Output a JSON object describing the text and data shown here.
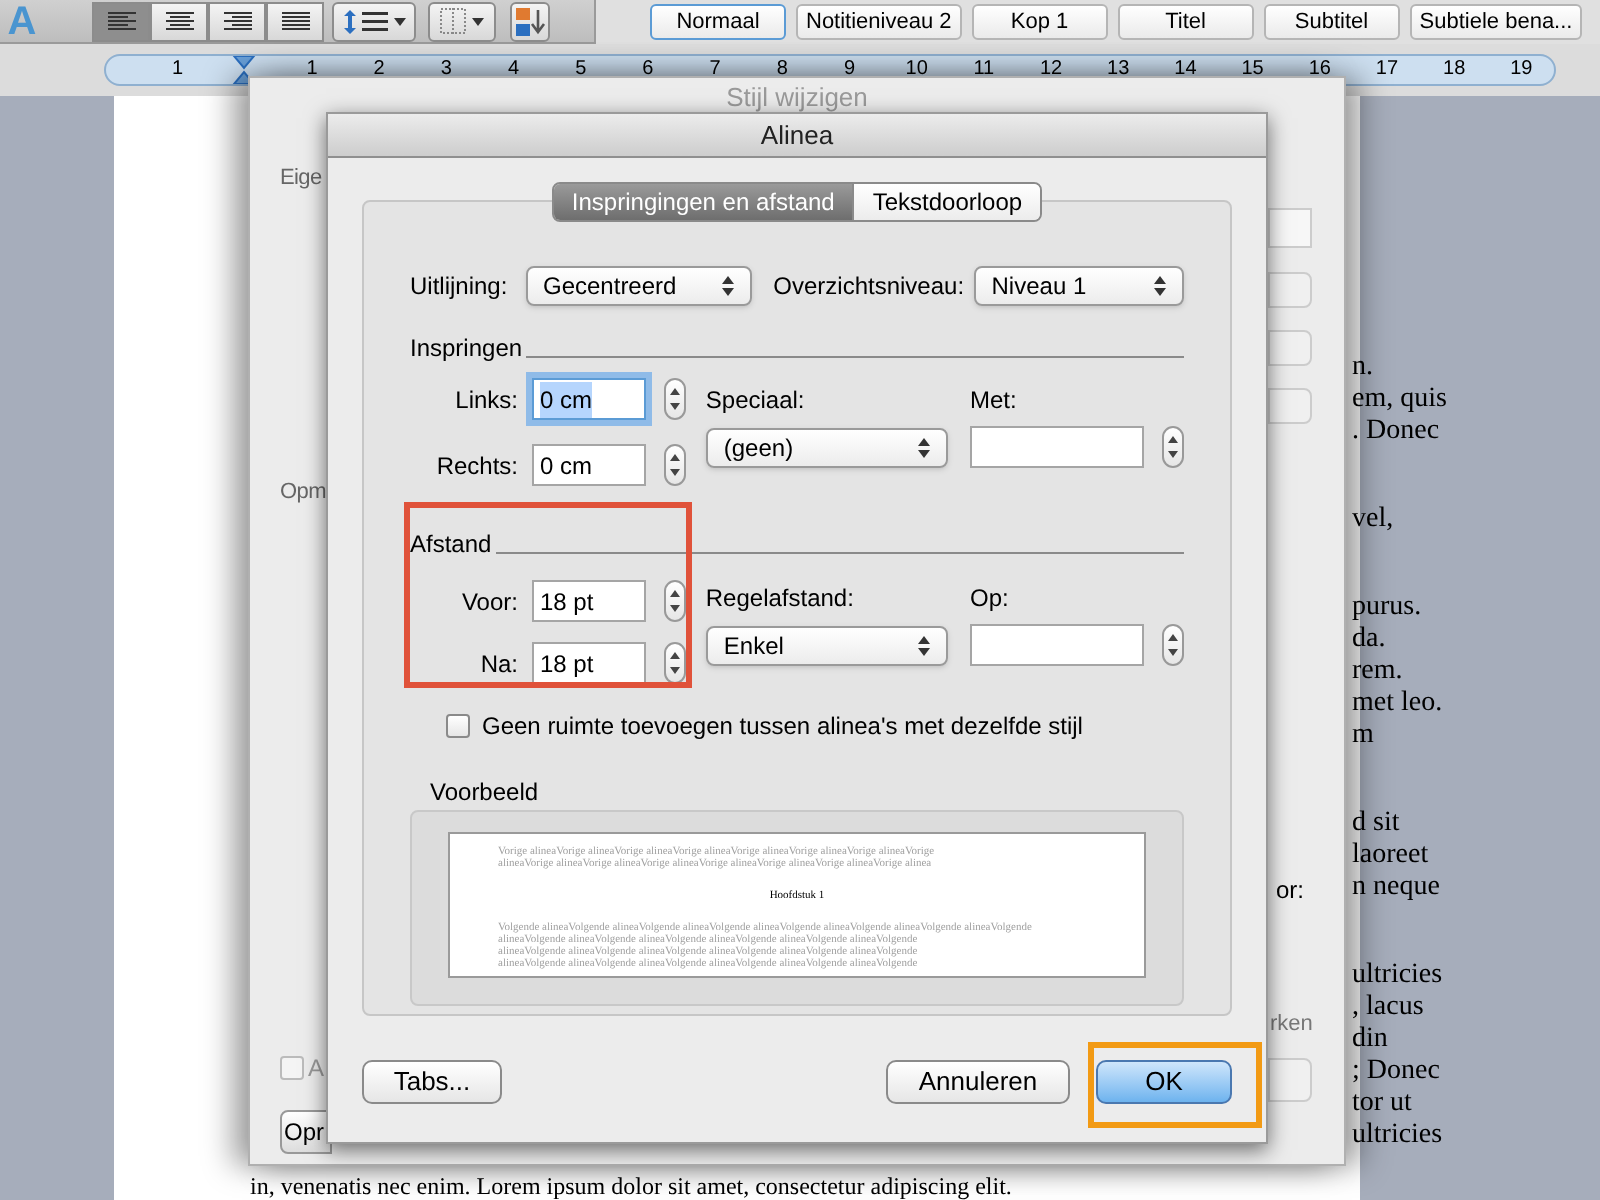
{
  "toolbar": {
    "text_effects": "A",
    "align_buttons": [
      {
        "kind": "left",
        "selected": true
      },
      {
        "kind": "center",
        "selected": false
      },
      {
        "kind": "right",
        "selected": false
      },
      {
        "kind": "justify",
        "selected": false
      }
    ],
    "styles": [
      {
        "label": "Normaal",
        "selected": true
      },
      {
        "label": "Notitieniveau 2",
        "selected": false
      },
      {
        "label": "Kop 1",
        "selected": false
      },
      {
        "label": "Titel",
        "selected": false
      },
      {
        "label": "Subtitel",
        "selected": false
      },
      {
        "label": "Subtiele bena...",
        "selected": false
      }
    ]
  },
  "ruler": {
    "numbers": [
      "1",
      "1",
      "2",
      "3",
      "4",
      "5",
      "6",
      "7",
      "8",
      "9",
      "10",
      "11",
      "12",
      "13",
      "14",
      "15",
      "16",
      "17",
      "18",
      "19"
    ]
  },
  "document": {
    "paragraphs": [
      [
        "n.",
        "em, quis",
        ". Donec"
      ],
      [
        "vel,"
      ],
      [
        "purus.",
        "da.",
        "rem.",
        "met leo.",
        "m"
      ],
      [
        "d sit",
        "laoreet",
        "n neque"
      ],
      [
        "ultricies",
        ", lacus",
        "din",
        "; Donec",
        "tor ut",
        "ultricies"
      ]
    ],
    "bottom_line": "in, venenatis nec enim. Lorem ipsum dolor sit amet, consectetur adipiscing elit."
  },
  "style_dialog": {
    "title": "Stijl wijzigen",
    "labels": [
      "Eige",
      "Opm"
    ],
    "right_labels": [
      "or:",
      "rken"
    ],
    "checkbox": {
      "label": "A",
      "checked": false
    },
    "button": "Opr"
  },
  "dialog": {
    "title": "Alinea",
    "tabs": [
      {
        "label": "Inspringingen en afstand",
        "selected": true
      },
      {
        "label": "Tekstdoorloop",
        "selected": false
      }
    ],
    "alignment": {
      "label": "Uitlijning:",
      "value": "Gecentreerd"
    },
    "outline_level": {
      "label": "Overzichtsniveau:",
      "value": "Niveau 1"
    },
    "indent": {
      "heading": "Inspringen",
      "fields": [
        {
          "label": "Links:",
          "value": "0 cm",
          "focused": true
        },
        {
          "label": "Rechts:",
          "value": "0 cm",
          "focused": false
        }
      ],
      "special": {
        "label": "Speciaal:",
        "value": "(geen)"
      },
      "by": {
        "label": "Met:"
      }
    },
    "spacing": {
      "heading": "Afstand",
      "fields": [
        {
          "label": "Voor:",
          "value": "18 pt",
          "focused": false
        },
        {
          "label": "Na:",
          "value": "18 pt",
          "focused": false
        }
      ],
      "line_spacing": {
        "label": "Regelafstand:",
        "value": "Enkel"
      },
      "at": {
        "label": "Op:"
      }
    },
    "no_extra_space": {
      "label": "Geen ruimte toevoegen tussen alinea's met dezelfde stijl",
      "checked": false
    },
    "preview": {
      "label": "Voorbeeld",
      "previous_lines": [
        "Vorige alineaVorige alineaVorige alineaVorige alineaVorige alineaVorige alineaVorige alineaVorige",
        "alineaVorige alineaVorige alineaVorige alineaVorige alineaVorige alineaVorige alineaVorige alinea"
      ],
      "heading": "Hoofdstuk 1",
      "next_lines": [
        "Volgende alineaVolgende alineaVolgende alineaVolgende alineaVolgende alineaVolgende alineaVolgende alineaVolgende",
        "alineaVolgende alineaVolgende alineaVolgende alineaVolgende alineaVolgende alineaVolgende",
        "alineaVolgende alineaVolgende alineaVolgende alineaVolgende alineaVolgende alineaVolgende",
        "alineaVolgende alineaVolgende alineaVolgende alineaVolgende alineaVolgende alineaVolgende"
      ]
    },
    "tabs_button": "Tabs...",
    "buttons": [
      {
        "label": "Annuleren",
        "default": false
      },
      {
        "label": "OK",
        "default": true
      }
    ]
  }
}
